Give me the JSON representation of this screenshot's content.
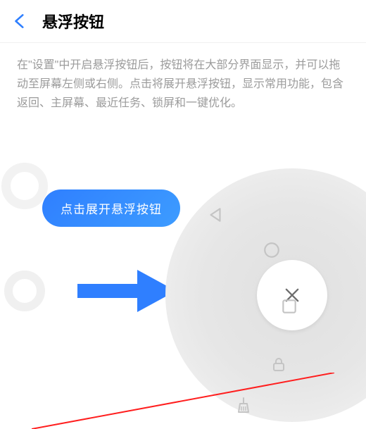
{
  "header": {
    "title": "悬浮按钮"
  },
  "description": "在\"设置\"中开启悬浮按钮后，按钮将在大部分界面显示，并可以拖动至屏幕左侧或右侧。点击将展开悬浮按钮，显示常用功能，包含返回、主屏幕、最近任务、锁屏和一键优化。",
  "tooltip": {
    "label": "点击展开悬浮按钮"
  },
  "radial": {
    "center_icon": "close-icon",
    "items": [
      {
        "name": "back-triangle-icon"
      },
      {
        "name": "home-circle-icon"
      },
      {
        "name": "recent-square-icon"
      },
      {
        "name": "lock-icon"
      },
      {
        "name": "broom-icon"
      }
    ]
  },
  "colors": {
    "accent": "#2f7fff",
    "icon_gray": "#b7b7b7",
    "text_gray": "#9b9b9b"
  }
}
